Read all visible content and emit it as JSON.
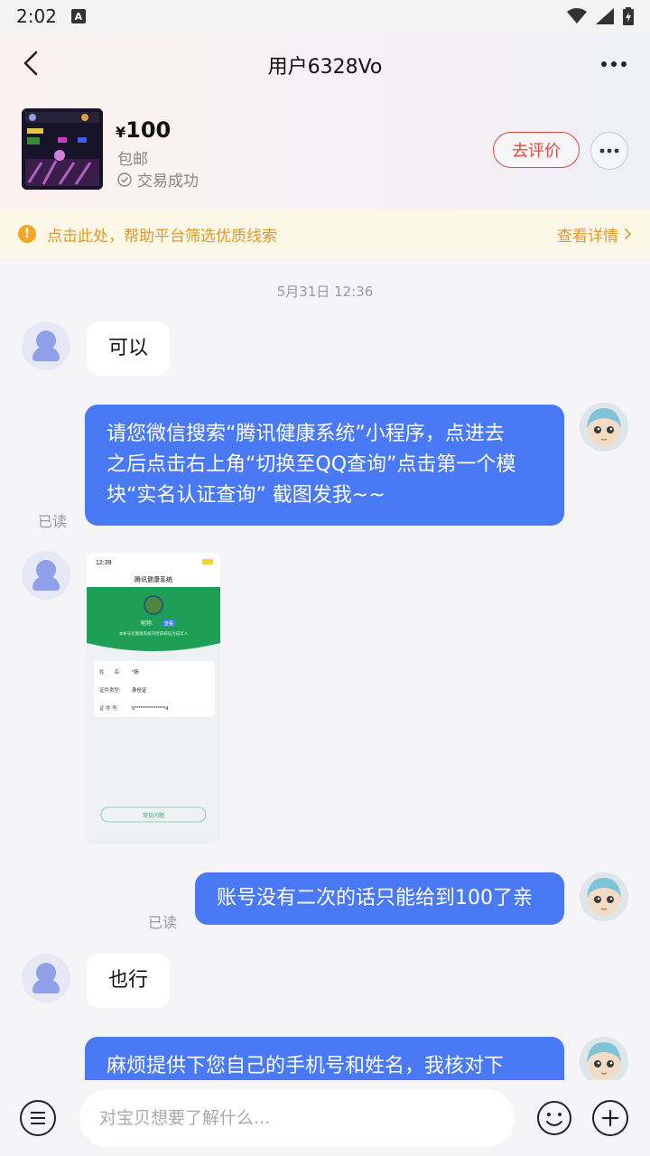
{
  "status_bar": {
    "time": "2:02",
    "a_icon": "A"
  },
  "header": {
    "title": "用户6328Vo",
    "price_symbol": "¥",
    "price": "100",
    "shipping": "包邮",
    "deal_status": "交易成功",
    "rate_button": "去评价"
  },
  "notice": {
    "text": "点击此处，帮助平台筛选优质线索",
    "link": "查看详情"
  },
  "chat": {
    "timestamp": "5月31日 12:36",
    "msg1": "可以",
    "msg2_line1": "请您微信搜索“腾讯健康系统”小程序，点进去",
    "msg2_line2": "之后点击右上角“切换至QQ查询”点击第一个模",
    "msg2_line3": "块“实名认证查询” 截图发我~~",
    "read_label": "已读",
    "shot": {
      "time": "12:39",
      "title": "腾讯健康系统",
      "nickname": "昵称:",
      "badge": "查看",
      "note": "本帐号仅健康系统内所获取证为成年人",
      "name_label": "姓　　名:",
      "name_value": "*扬",
      "idtype_label": "证件类型:",
      "idtype_value": "身份证",
      "idnum_label": "证 件 号:",
      "idnum_value": "5****************4",
      "btn": "常见问题"
    },
    "msg4": "账号没有二次的话只能给到100了亲",
    "msg5": "也行",
    "msg6": "麻烦提供下您自己的手机号和姓名，我核对下"
  },
  "input": {
    "placeholder": "对宝贝想要了解什么..."
  },
  "colors": {
    "accent": "#4a79f5",
    "rate": "#e8453c",
    "notice": "#e09a2b"
  }
}
